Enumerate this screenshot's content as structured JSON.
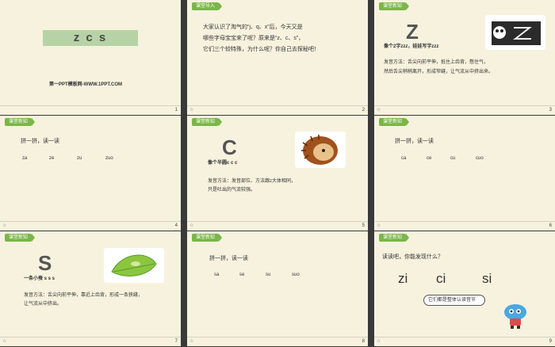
{
  "slides": [
    {
      "num": "1",
      "title": "z c s",
      "site": "第一PPT模板网-WWW.1PPT.COM"
    },
    {
      "num": "2",
      "tag": "课堂导入",
      "lines": [
        "大家认识了淘气的“j、q、x”后，今天又是",
        "哪些字母宝宝来了呢？原来是“z、c、s”，",
        "它们三个较特殊，为什么呢？你自己去探秘吧！"
      ]
    },
    {
      "num": "3",
      "tag": "课堂新知",
      "letter": "Z",
      "caption": "像个2字zzz，娃娃写字zzz",
      "desc": [
        "发音方法：舌尖向前平伸，抵住上齿背，憋住气，",
        "然后舌尖稍稍离开，形成窄缝，让气流从中挤出来。"
      ]
    },
    {
      "num": "4",
      "tag": "课堂新知",
      "heading": "拼一拼，读一读",
      "syll": [
        "za",
        "ze",
        "zu",
        "zuo"
      ]
    },
    {
      "num": "5",
      "tag": "课堂新知",
      "letter": "C",
      "caption": "像个半圆c c c",
      "desc": [
        "发音方法：发音部位、方法跟z大体相同，",
        "只是吐出的气流较强。"
      ]
    },
    {
      "num": "6",
      "tag": "课堂新知",
      "heading": "拼一拼，读一读",
      "syll": [
        "ca",
        "ce",
        "cu",
        "cuo"
      ]
    },
    {
      "num": "7",
      "tag": "课堂新知",
      "letter": "S",
      "caption": "一条小蚕 s s s",
      "desc": [
        "发音方法：舌尖向前平伸，靠近上齿背，形成一条狭缝，",
        "让气流从中挤出。"
      ]
    },
    {
      "num": "8",
      "tag": "课堂新知",
      "heading": "拼一拼，读一读",
      "syll": [
        "sa",
        "se",
        "su",
        "suo"
      ]
    },
    {
      "num": "9",
      "tag": "课堂新知",
      "heading": "读读吧，你能发现什么？",
      "syll": [
        "zi",
        "ci",
        "si"
      ],
      "bubble": "它们都是整体认读音节"
    }
  ]
}
